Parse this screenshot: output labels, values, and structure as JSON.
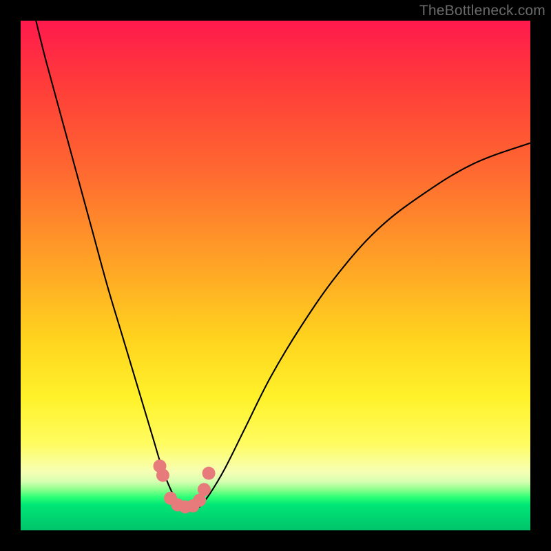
{
  "watermark": "TheBottleneck.com",
  "colors": {
    "frame": "#000000",
    "curve": "#000000",
    "marker": "#e77a7a",
    "gradient_top": "#ff1a4d",
    "gradient_bottom": "#00c46a"
  },
  "chart_data": {
    "type": "line",
    "title": "",
    "xlabel": "",
    "ylabel": "",
    "xlim": [
      0,
      100
    ],
    "ylim": [
      0,
      100
    ],
    "grid": false,
    "legend": false,
    "note": "No axis ticks or numeric labels are visible; values are read as relative percentages of the plotting area (0 at bottom-left, 100 at top-right). Two black curves descend into a V near x≈30–35 and y≈5, with salmon markers along the trough.",
    "series": [
      {
        "name": "left-branch",
        "x": [
          3,
          5,
          8,
          11,
          14,
          17,
          20,
          23,
          26,
          27.5,
          29,
          30.5,
          32
        ],
        "y": [
          100,
          92,
          81,
          70,
          59,
          48,
          38,
          28,
          18,
          13,
          9,
          6,
          4.5
        ]
      },
      {
        "name": "right-branch",
        "x": [
          35,
          37,
          40,
          44,
          49,
          55,
          62,
          70,
          79,
          89,
          100
        ],
        "y": [
          4.5,
          7,
          12,
          20,
          30,
          40,
          50,
          59,
          66,
          72,
          76
        ]
      },
      {
        "name": "trough-markers",
        "marker_only": true,
        "x": [
          27.3,
          27.9,
          29.4,
          30.8,
          32.3,
          33.8,
          35.1,
          36.0,
          36.9
        ],
        "y": [
          12.6,
          10.8,
          6.3,
          5.0,
          4.6,
          4.8,
          5.9,
          8.0,
          11.2
        ]
      }
    ]
  }
}
